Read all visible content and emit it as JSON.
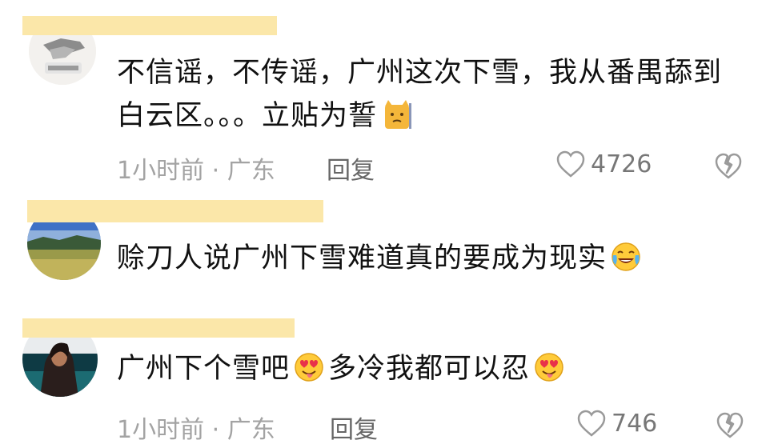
{
  "comments": [
    {
      "text": "不信谣，不传谣，广州这次下雪，我从番禺舔到白云区。。。立贴为誓",
      "emoji": "cat-emoji",
      "time": "1小时前 · 广东",
      "reply_label": "回复",
      "likes": "4726"
    },
    {
      "text": "赊刀人说广州下雪难道真的要成为现实",
      "emoji": "laughing-crying-emoji"
    },
    {
      "text_a": "广州下个雪吧",
      "text_b": "多冷我都可以忍",
      "emoji": "heart-eyes-tongue-emoji",
      "time": "1小时前 · 广东",
      "reply_label": "回复",
      "likes": "746"
    }
  ],
  "colors": {
    "name_bar": "#fbe7a9",
    "meta": "#a3a3a3",
    "text": "#111111"
  }
}
